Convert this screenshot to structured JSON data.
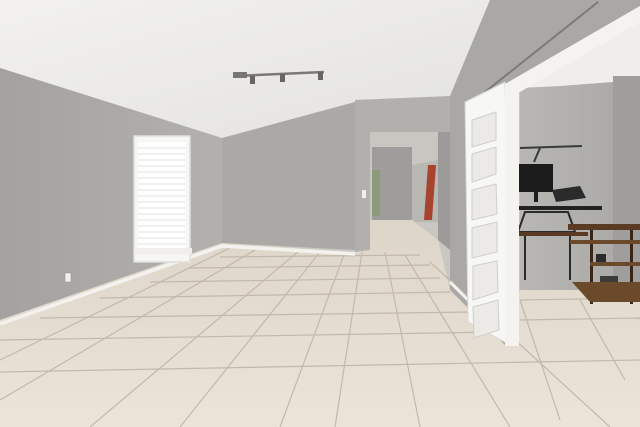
{
  "scene": {
    "subject": "empty-room-interior",
    "colors": {
      "ceiling": "#ecebe8",
      "wall_left": "#a9a8a6",
      "wall_back": "#a4a3a1",
      "wall_right": "#b0afad",
      "floor_light": "#e8e1d6",
      "floor_dark": "#d6cdbf",
      "grout": "#c2b8a8",
      "baseboard": "#f4f2ee",
      "door_white": "#f7f7f5",
      "accent_red": "#a8432d",
      "desk_wood": "#5a3a22"
    },
    "objects": [
      "track-light",
      "window-blinds",
      "sliding-barn-door",
      "standing-desk",
      "computer-monitor",
      "wood-shelf",
      "hallway-opening"
    ]
  }
}
